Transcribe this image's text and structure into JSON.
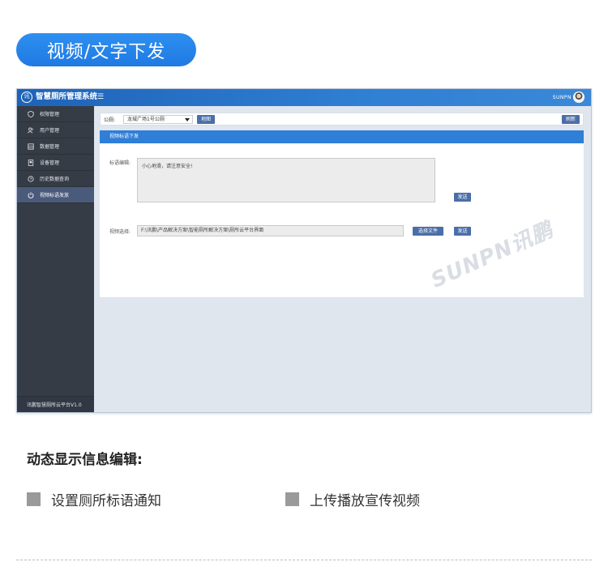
{
  "section_pill": "视频/文字下发",
  "app": {
    "title": "智慧厕所管理系统",
    "logo_text": "讯",
    "menu_icon": "☰",
    "user": "SUNPN"
  },
  "sidebar": {
    "items": [
      {
        "label": "权限管理",
        "icon": "shield-icon"
      },
      {
        "label": "用户管理",
        "icon": "users-icon"
      },
      {
        "label": "数据管理",
        "icon": "database-icon"
      },
      {
        "label": "设备管理",
        "icon": "device-icon"
      },
      {
        "label": "历史数据查询",
        "icon": "history-icon"
      },
      {
        "label": "视频标语发放",
        "icon": "power-icon",
        "active": true
      }
    ],
    "footer": "讯鹏智慧厕所云平台V1.0"
  },
  "filter": {
    "label": "公厕:",
    "selected": "龙城广场1号公厕",
    "map_button": "地图",
    "refresh_button": "刷新"
  },
  "panel": {
    "header": "视频标语下发",
    "slogan_label": "标语编辑:",
    "slogan_value": "小心地滑，请注意安全!",
    "send_button": "发送",
    "video_label": "视频选择:",
    "video_path": "F:\\讯鹏\\产品解决方案\\智能厕所解决方案\\厕所云平台界面",
    "choose_file_button": "选择文件",
    "send_button_2": "发送"
  },
  "watermark": "SUNPN讯鹏",
  "description": {
    "title": "动态显示信息编辑:",
    "features": [
      "设置厕所标语通知",
      "上传播放宣传视频"
    ]
  }
}
